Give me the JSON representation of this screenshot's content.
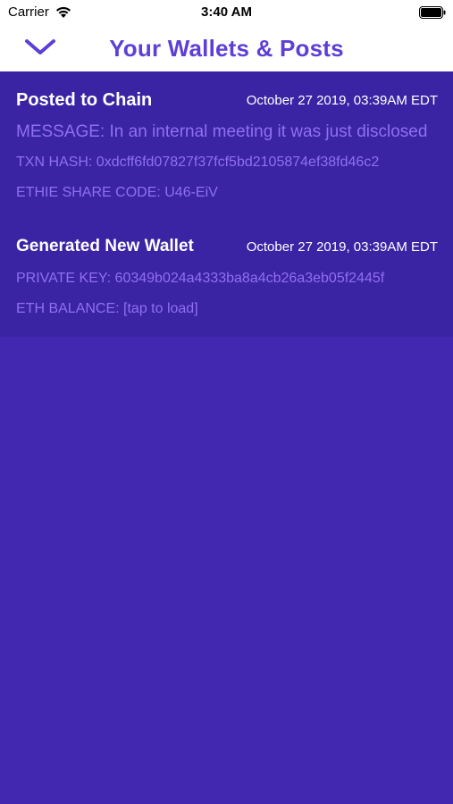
{
  "status_bar": {
    "carrier": "Carrier",
    "time": "3:40 AM",
    "icons": [
      "wifi-icon",
      "battery-icon"
    ]
  },
  "nav": {
    "title": "Your Wallets & Posts",
    "back_icon": "chevron-down-icon"
  },
  "colors": {
    "accent": "#5e3fd6",
    "background": "#4227b0",
    "card_background": "#3a24a4",
    "secondary_text": "#8f6ff3"
  },
  "items": [
    {
      "title": "Posted to Chain",
      "date": "October 27 2019, 03:39AM EDT",
      "lines": [
        "MESSAGE: In an internal meeting it was just disclosed",
        "TXN HASH: 0xdcff6fd07827f37fcf5bd2105874ef38fd46c2",
        "ETHIE SHARE CODE: U46-EiV"
      ]
    },
    {
      "title": "Generated New Wallet",
      "date": "October 27 2019, 03:39AM EDT",
      "lines": [
        "PRIVATE KEY: 60349b024a4333ba8a4cb26a3eb05f2445f",
        "ETH BALANCE: [tap to load]"
      ]
    }
  ]
}
